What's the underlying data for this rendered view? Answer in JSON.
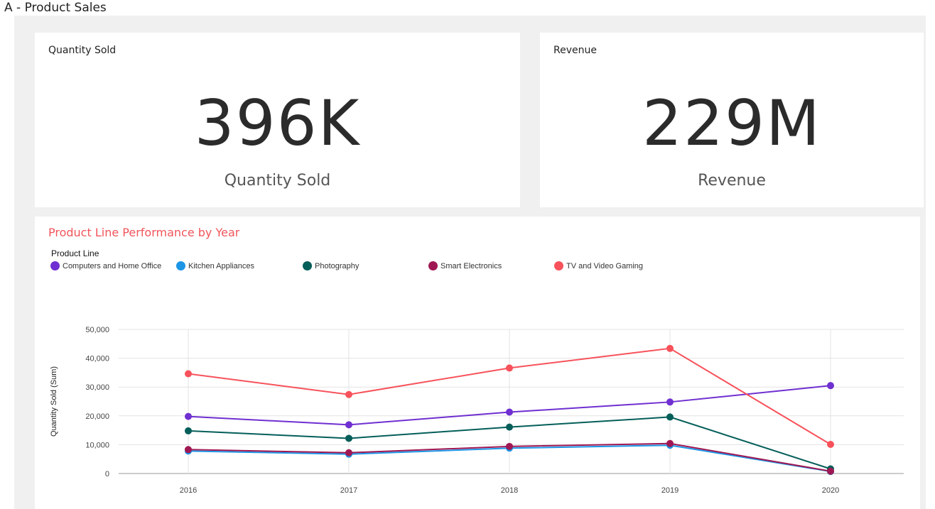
{
  "page": {
    "title": "A - Product Sales"
  },
  "kpis": {
    "quantity": {
      "card_title": "Quantity Sold",
      "value": "396K",
      "label": "Quantity Sold"
    },
    "revenue": {
      "card_title": "Revenue",
      "value": "229M",
      "label": "Revenue"
    }
  },
  "chart_card": {
    "title": "Product Line Performance by Year",
    "legend_title": "Product Line"
  },
  "chart_data": {
    "type": "line",
    "title": "Product Line Performance by Year",
    "xlabel": "",
    "ylabel": "Quantity Sold (Sum)",
    "x": [
      "2016",
      "2017",
      "2018",
      "2019",
      "2020"
    ],
    "ylim": [
      0,
      50000
    ],
    "yticks": [
      0,
      10000,
      20000,
      30000,
      40000,
      50000
    ],
    "ytick_labels": [
      "0",
      "10,000",
      "20,000",
      "30,000",
      "40,000",
      "50,000"
    ],
    "grid": true,
    "legend_position": "top-left",
    "series": [
      {
        "name": "Computers and Home Office",
        "color": "#6f2fd1",
        "values": [
          19800,
          16900,
          21300,
          24800,
          30500
        ]
      },
      {
        "name": "Kitchen Appliances",
        "color": "#1d95e6",
        "values": [
          7800,
          6700,
          8800,
          9800,
          700
        ]
      },
      {
        "name": "Photography",
        "color": "#045e59",
        "values": [
          14800,
          12200,
          16100,
          19600,
          1600
        ]
      },
      {
        "name": "Smart Electronics",
        "color": "#9f1853",
        "values": [
          8300,
          7200,
          9400,
          10400,
          800
        ]
      },
      {
        "name": "TV and Video Gaming",
        "color": "#f7525b",
        "values": [
          34600,
          27400,
          36600,
          43400,
          10100
        ]
      }
    ]
  }
}
